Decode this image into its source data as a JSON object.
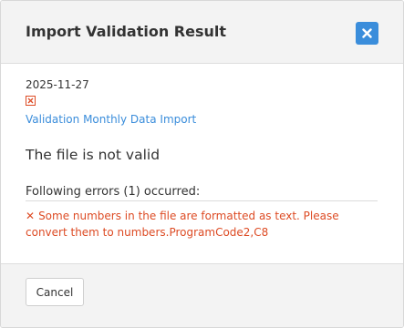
{
  "dialog": {
    "title": "Import Validation Result",
    "close_icon": "close-x-icon"
  },
  "colors": {
    "accent": "#3a8ddb",
    "error": "#dd4b24",
    "header_bg": "#f3f3f3",
    "text": "#333333"
  },
  "result": {
    "date": "2025-11-27",
    "file_icon": "error-file-icon",
    "import_link": "Validation Monthly Data Import",
    "status": "The file is not valid",
    "errors_heading": "Following errors (1) occurred:",
    "errors": [
      {
        "icon": "x-mark-icon",
        "line1": "Some numbers in the file are formatted as text. Please",
        "line2": "convert them to numbers.ProgramCode2,C8"
      }
    ]
  },
  "footer": {
    "cancel_label": "Cancel"
  }
}
